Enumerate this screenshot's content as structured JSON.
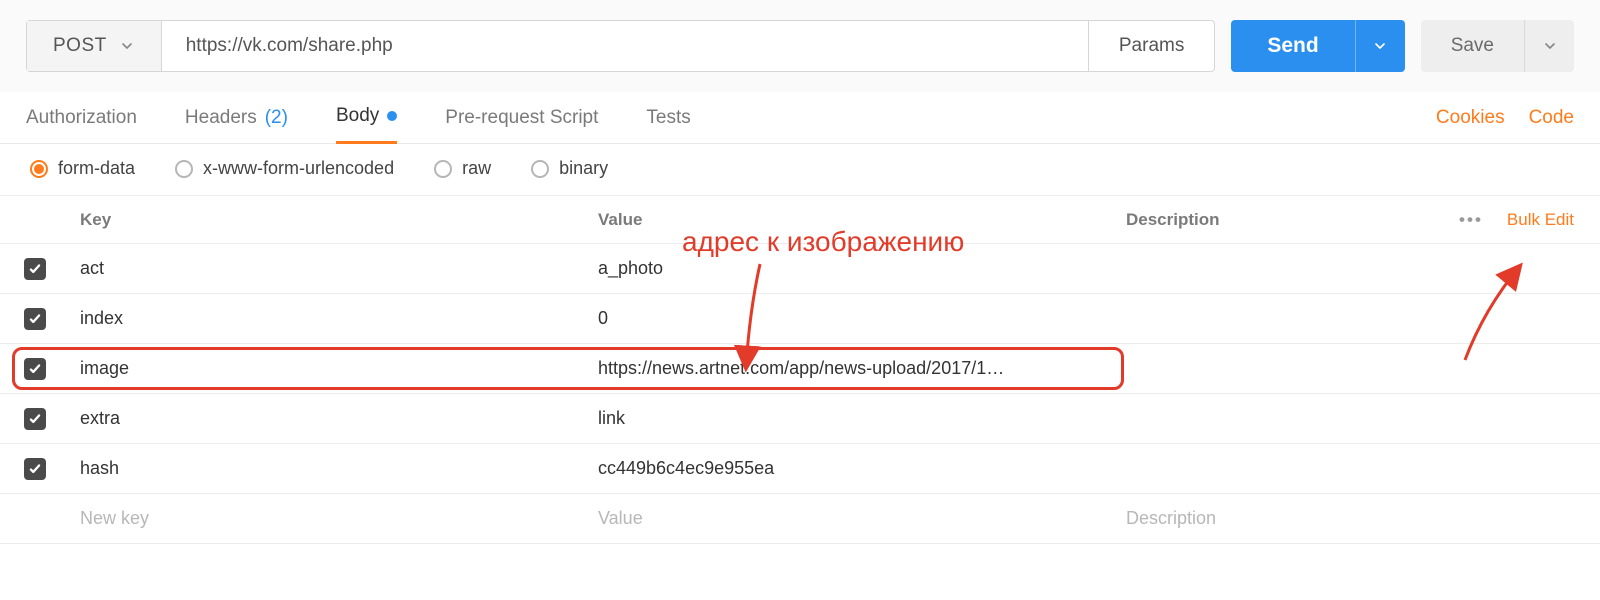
{
  "actionbar": {
    "method": "POST",
    "url": "https://vk.com/share.php",
    "params_label": "Params",
    "send_label": "Send",
    "save_label": "Save"
  },
  "tabs": {
    "authorization": "Authorization",
    "headers": "Headers",
    "headers_count": "(2)",
    "body": "Body",
    "prerequest": "Pre-request Script",
    "tests": "Tests",
    "cookies": "Cookies",
    "code": "Code"
  },
  "bodytype": {
    "formdata": "form-data",
    "urlencoded": "x-www-form-urlencoded",
    "raw": "raw",
    "binary": "binary"
  },
  "kvheader": {
    "key": "Key",
    "value": "Value",
    "description": "Description",
    "bulkedit": "Bulk Edit"
  },
  "rows": [
    {
      "key": "act",
      "value": "a_photo"
    },
    {
      "key": "index",
      "value": "0"
    },
    {
      "key": "image",
      "value": "https://news.artnet.com/app/news-upload/2017/1…"
    },
    {
      "key": "extra",
      "value": "link"
    },
    {
      "key": "hash",
      "value": "cc449b6c4ec9e955ea"
    }
  ],
  "placeholder": {
    "key": "New key",
    "value": "Value",
    "description": "Description"
  },
  "annotation": {
    "text": "адрес к изображению"
  }
}
